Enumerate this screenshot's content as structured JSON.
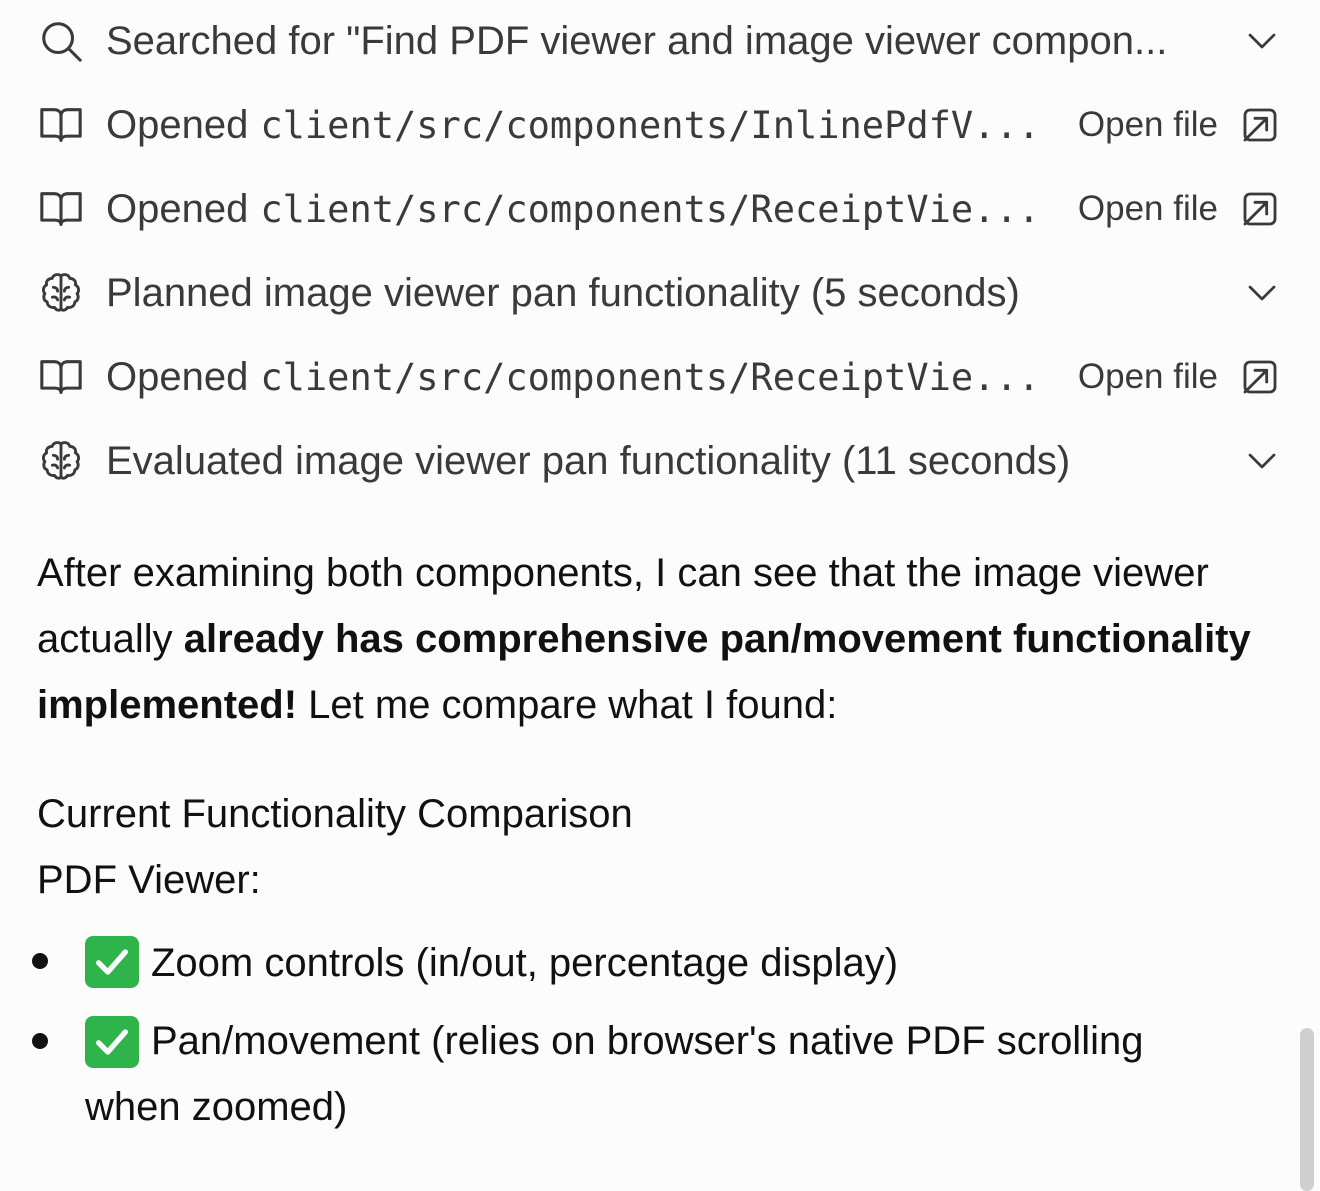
{
  "activity": [
    {
      "icon": "search-icon",
      "prefix": "Searched for \"Find PDF viewer and image viewer compon...",
      "path": "",
      "action": "",
      "trail": "chevron-down-icon"
    },
    {
      "icon": "book-icon",
      "prefix": "Opened",
      "path": "client/src/components/InlinePdfV...",
      "action": "Open file",
      "trail": "open-external-icon"
    },
    {
      "icon": "book-icon",
      "prefix": "Opened",
      "path": "client/src/components/ReceiptVie...",
      "action": "Open file",
      "trail": "open-external-icon"
    },
    {
      "icon": "brain-icon",
      "prefix": "Planned image viewer pan functionality (5 seconds)",
      "path": "",
      "action": "",
      "trail": "chevron-down-icon"
    },
    {
      "icon": "book-icon",
      "prefix": "Opened",
      "path": "client/src/components/ReceiptVie...",
      "action": "Open file",
      "trail": "open-external-icon"
    },
    {
      "icon": "brain-icon",
      "prefix": "Evaluated image viewer pan functionality (11 seconds)",
      "path": "",
      "action": "",
      "trail": "chevron-down-icon"
    }
  ],
  "message": {
    "intro": "After examining both components, I can see that the image viewer actually ",
    "bold": "already has comprehensive pan/movement functionality implemented!",
    "outro": " Let me compare what I found:",
    "heading": "Current Functionality Comparison",
    "subheading": "PDF Viewer:",
    "bullets": [
      "Zoom controls (in/out, percentage display)",
      "Pan/movement (relies on browser's native PDF scrolling when zoomed)"
    ]
  }
}
